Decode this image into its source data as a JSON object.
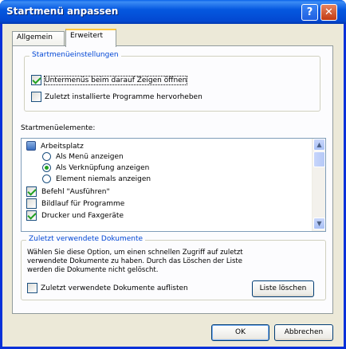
{
  "window": {
    "title": "Startmenü anpassen",
    "help_glyph": "?",
    "close_glyph": "✕"
  },
  "tabs": [
    {
      "label": "Allgemein"
    },
    {
      "label": "Erweitert"
    }
  ],
  "settings_group": {
    "title": "Startmenüeinstellungen",
    "option1": "Untermenüs beim darauf Zeigen öffnen",
    "option2": "Zuletzt installierte Programme hervorheben"
  },
  "items_label": "Startmenüelemente:",
  "items": {
    "arbeitsplatz": "Arbeitsplatz",
    "as_menu": "Als Menü anzeigen",
    "as_link": "Als Verknüpfung anzeigen",
    "never": "Element niemals anzeigen",
    "run": "Befehl \"Ausführen\"",
    "scroll": "Bildlauf für Programme",
    "printers": "Drucker und Faxgeräte"
  },
  "recent_group": {
    "title": "Zuletzt verwendete Dokumente",
    "description_line1": "Wählen Sie diese Option, um einen schnellen Zugriff auf zuletzt",
    "description_line2": "verwendete Dokumente zu haben. Durch das Löschen der Liste",
    "description_line3": "werden die Dokumente nicht gelöscht.",
    "checkbox_label": "Zuletzt verwendete Dokumente auflisten",
    "clear_button": "Liste löschen"
  },
  "buttons": {
    "ok": "OK",
    "cancel": "Abbrechen"
  },
  "scroll": {
    "up": "▲",
    "down": "▼"
  }
}
